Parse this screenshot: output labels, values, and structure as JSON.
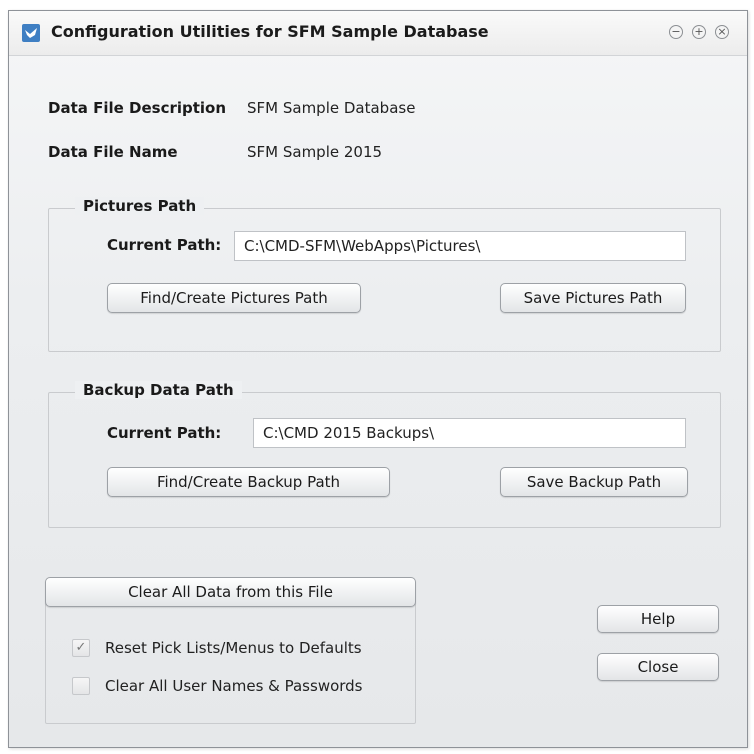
{
  "window": {
    "title": "Configuration Utilities for SFM Sample Database"
  },
  "info": {
    "desc_label": "Data File Description",
    "desc_value": "SFM Sample Database",
    "name_label": "Data File Name",
    "name_value": "SFM Sample 2015"
  },
  "pictures": {
    "legend": "Pictures Path",
    "current_label": "Current Path:",
    "current_value": "C:\\CMD-SFM\\WebApps\\Pictures\\",
    "find_button": "Find/Create Pictures Path",
    "save_button": "Save Pictures Path"
  },
  "backup": {
    "legend": "Backup Data Path",
    "current_label": "Current Path:",
    "current_value": "C:\\CMD 2015 Backups\\",
    "find_button": "Find/Create Backup Path",
    "save_button": "Save Backup Path"
  },
  "clear": {
    "button": "Clear All Data from this File",
    "options": [
      {
        "label": "Reset Pick Lists/Menus to Defaults",
        "checked": true
      },
      {
        "label": "Clear All User Names & Passwords",
        "checked": false
      }
    ]
  },
  "actions": {
    "help": "Help",
    "close": "Close"
  },
  "icons": {
    "app": "app-logo-icon",
    "minimize": "minimize-icon",
    "maximize": "maximize-icon",
    "close": "close-icon",
    "checkmark": "checkmark-icon"
  },
  "colors": {
    "app_icon": "#3f7fc3",
    "window_bg": "#eceef0"
  }
}
